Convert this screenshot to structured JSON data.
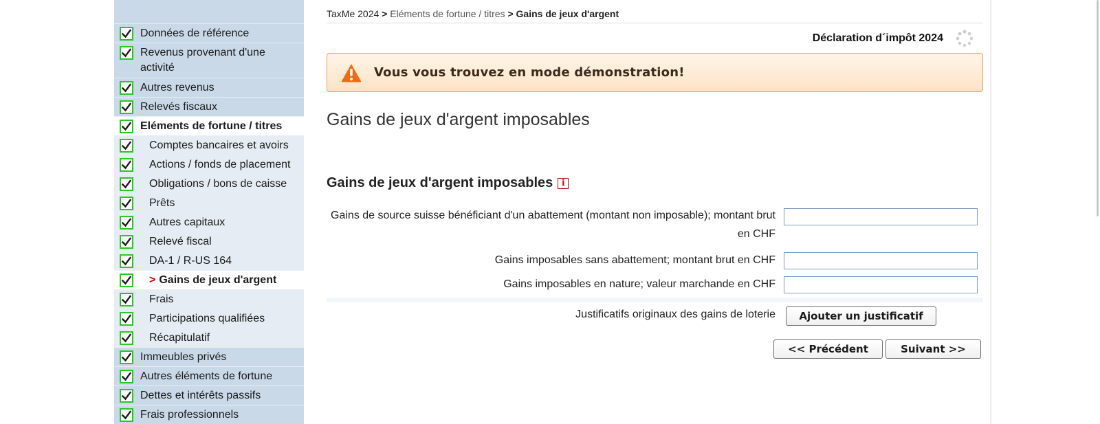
{
  "sidebar": {
    "items": [
      {
        "label": "Données de référence",
        "level": 0,
        "state": "normal"
      },
      {
        "label": "Revenus provenant d'une activité",
        "level": 0,
        "state": "normal"
      },
      {
        "label": "Autres revenus",
        "level": 0,
        "state": "normal"
      },
      {
        "label": "Relevés fiscaux",
        "level": 0,
        "state": "normal"
      },
      {
        "label": "Eléments de fortune / titres",
        "level": 0,
        "state": "active-parent"
      },
      {
        "label": "Comptes bancaires et avoirs",
        "level": 1,
        "state": "normal"
      },
      {
        "label": "Actions / fonds de placement",
        "level": 1,
        "state": "normal"
      },
      {
        "label": "Obligations / bons de caisse",
        "level": 1,
        "state": "normal"
      },
      {
        "label": "Prêts",
        "level": 1,
        "state": "normal"
      },
      {
        "label": "Autres capitaux",
        "level": 1,
        "state": "normal"
      },
      {
        "label": "Relevé fiscal",
        "level": 1,
        "state": "normal"
      },
      {
        "label": "DA-1 / R-US 164",
        "level": 1,
        "state": "normal"
      },
      {
        "label": "Gains de jeux d'argent",
        "level": 1,
        "state": "current"
      },
      {
        "label": "Frais",
        "level": 1,
        "state": "normal"
      },
      {
        "label": "Participations qualifiées",
        "level": 1,
        "state": "normal"
      },
      {
        "label": "Récapitulatif",
        "level": 1,
        "state": "normal"
      },
      {
        "label": "Immeubles privés",
        "level": 0,
        "state": "normal"
      },
      {
        "label": "Autres éléments de fortune",
        "level": 0,
        "state": "normal"
      },
      {
        "label": "Dettes et intérêts passifs",
        "level": 0,
        "state": "normal"
      },
      {
        "label": "Frais professionnels",
        "level": 0,
        "state": "normal"
      }
    ],
    "current_marker": ">"
  },
  "breadcrumb": {
    "root": "TaxMe 2024",
    "sep1": " > ",
    "mid": "Eléments de fortune / titres",
    "sep2": " > ",
    "current": "Gains de jeux d'argent"
  },
  "header": {
    "declaration_title": "Déclaration d´impôt 2024"
  },
  "banner": {
    "text": "Vous vous trouvez en mode démonstration!"
  },
  "main": {
    "page_title": "Gains de jeux d'argent imposables",
    "section_title": "Gains de jeux d'argent imposables",
    "info_icon_glyph": "i",
    "fields": [
      {
        "label_line1": "Gains de source suisse bénéficiant d'un abattement (montant non imposable); montant brut",
        "label_line2": "en CHF",
        "value": ""
      },
      {
        "label_line1": "Gains imposables sans abattement; montant brut en CHF",
        "value": ""
      },
      {
        "label_line1": "Gains imposables en nature; valeur marchande en CHF",
        "value": ""
      }
    ],
    "attachment_label": "Justificatifs originaux des gains de loterie",
    "attachment_button": "Ajouter un justificatif",
    "prev_button": "<< Précédent",
    "next_button": "Suivant >>"
  },
  "colors": {
    "sidebar_bg": "#c9d9e8",
    "check_border": "#27c81f",
    "banner_border": "#f0a04b",
    "warning_icon": "#f26a10",
    "current_marker": "#c00000"
  }
}
